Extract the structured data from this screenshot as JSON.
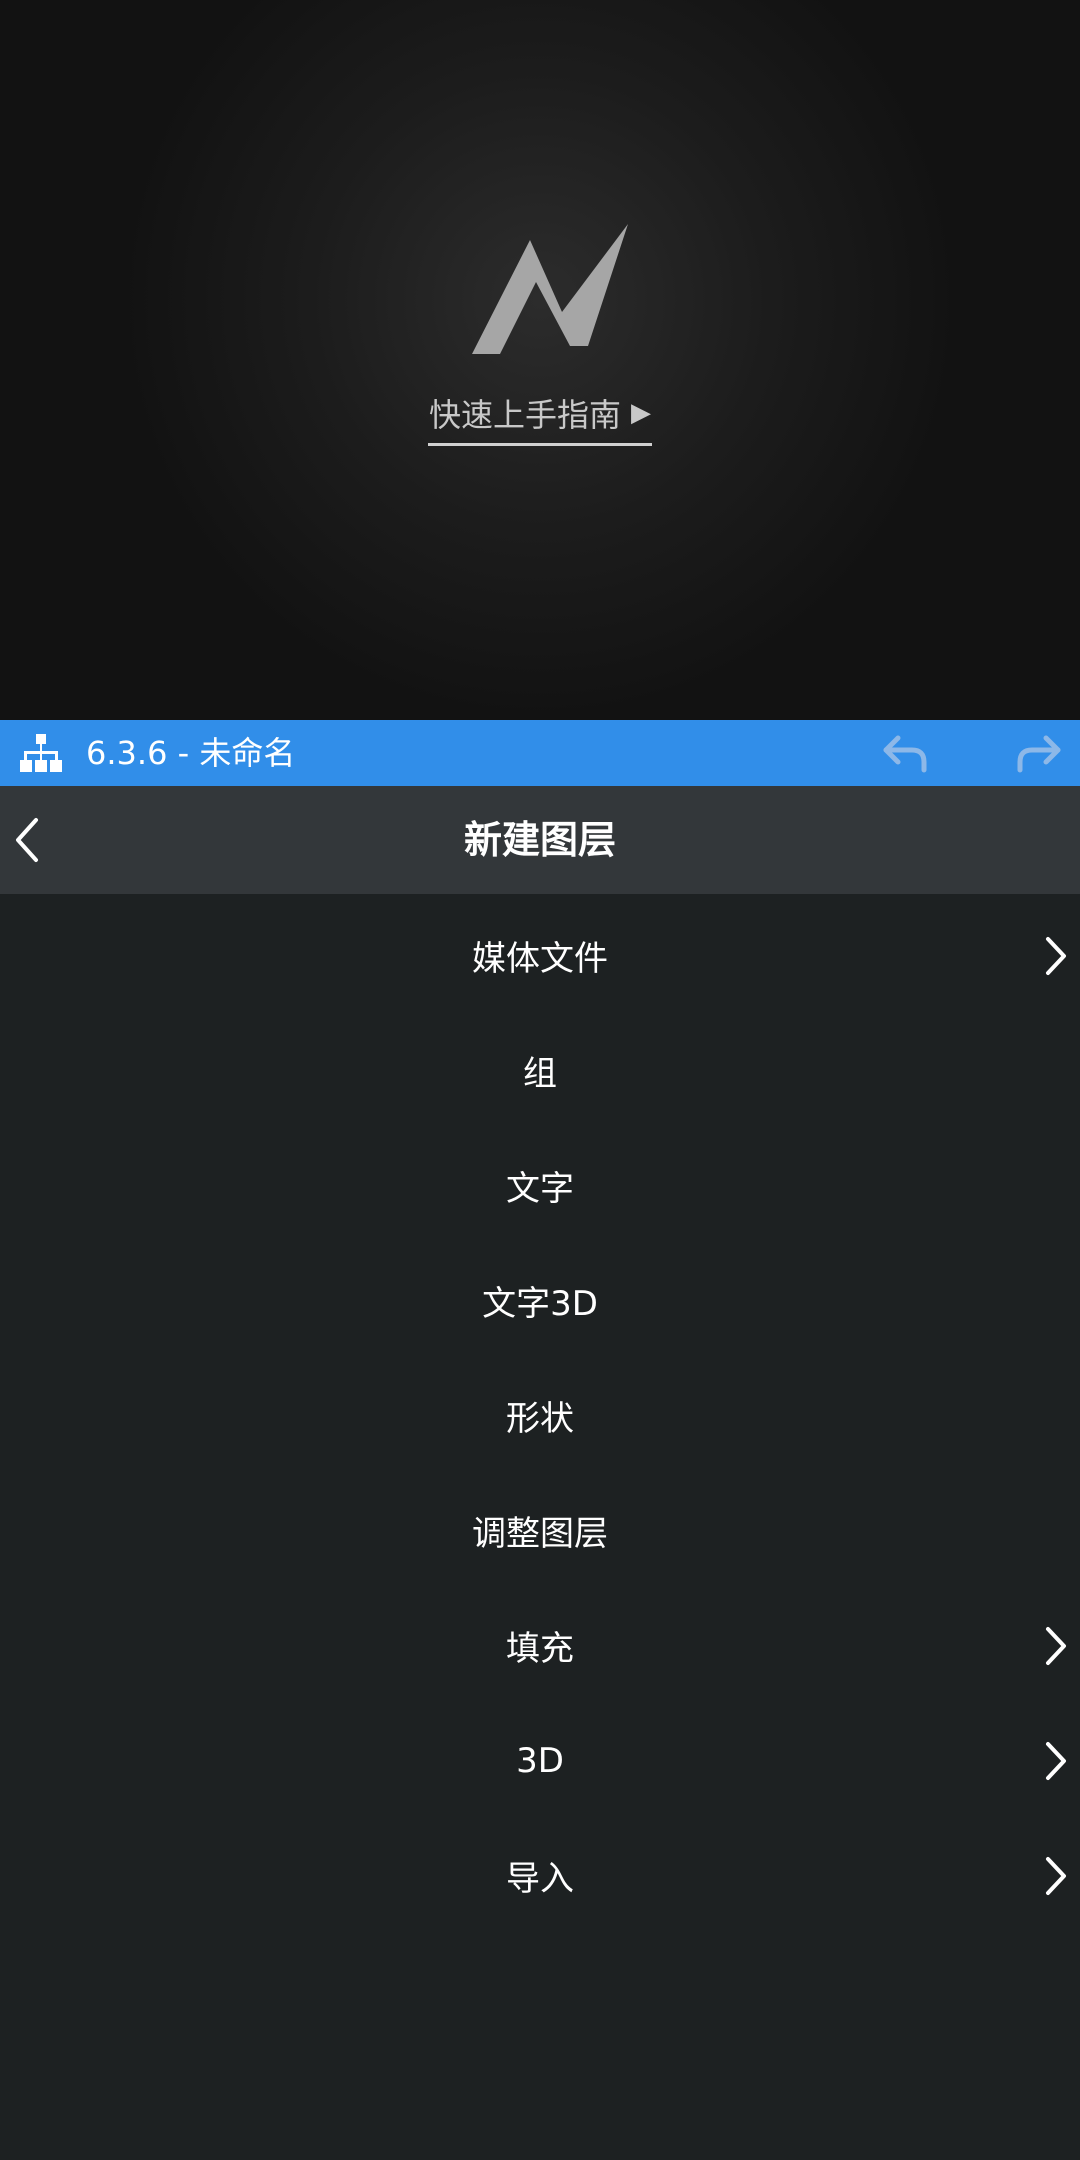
{
  "preview": {
    "guide_label": "快速上手指南",
    "guide_play_glyph": "▶"
  },
  "titlebar": {
    "title": "6.3.6 - 未命名",
    "color": "#318ee9"
  },
  "header": {
    "title": "新建图层"
  },
  "menu": {
    "items": [
      {
        "label": "媒体文件",
        "has_submenu": true
      },
      {
        "label": "组",
        "has_submenu": false
      },
      {
        "label": "文字",
        "has_submenu": false
      },
      {
        "label": "文字3D",
        "has_submenu": false
      },
      {
        "label": "形状",
        "has_submenu": false
      },
      {
        "label": "调整图层",
        "has_submenu": false
      },
      {
        "label": "填充",
        "has_submenu": true
      },
      {
        "label": "3D",
        "has_submenu": true
      },
      {
        "label": "导入",
        "has_submenu": true
      }
    ]
  }
}
